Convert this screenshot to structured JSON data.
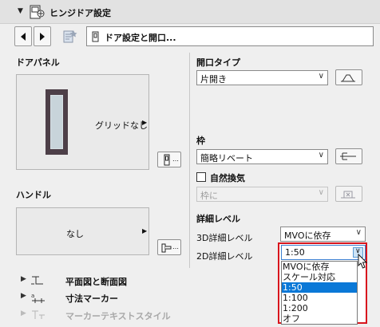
{
  "header": {
    "title": "ヒンジドア設定",
    "chevron": "▼"
  },
  "nav": {
    "field_label": "ドア設定と開口..."
  },
  "door_panel": {
    "label": "ドアパネル",
    "grid_value": "グリッドなし"
  },
  "handle": {
    "label": "ハンドル",
    "value": "なし"
  },
  "opening_type": {
    "label": "開口タイプ",
    "value": "片開き"
  },
  "frame": {
    "label": "枠",
    "value": "簡略リベート"
  },
  "natural_vent": {
    "label": "自然換気",
    "checked": false,
    "value": "枠に"
  },
  "detail_level": {
    "label": "詳細レベル",
    "row_3d": {
      "label": "3D詳細レベル",
      "value": "MVOに依存"
    },
    "row_2d": {
      "label": "2D詳細レベル",
      "value": "1:50"
    },
    "options": [
      "MVOに依存",
      "スケール対応",
      "1:50",
      "1:100",
      "1:200",
      "オフ"
    ],
    "selected_option": "1:50"
  },
  "sections": [
    {
      "label": "平面図と断面図"
    },
    {
      "label": "寸法マーカー"
    },
    {
      "label": "マーカーテキストスタイル"
    }
  ],
  "colors": {
    "accent": "#0a78d7",
    "highlight_border": "#d8151d"
  }
}
